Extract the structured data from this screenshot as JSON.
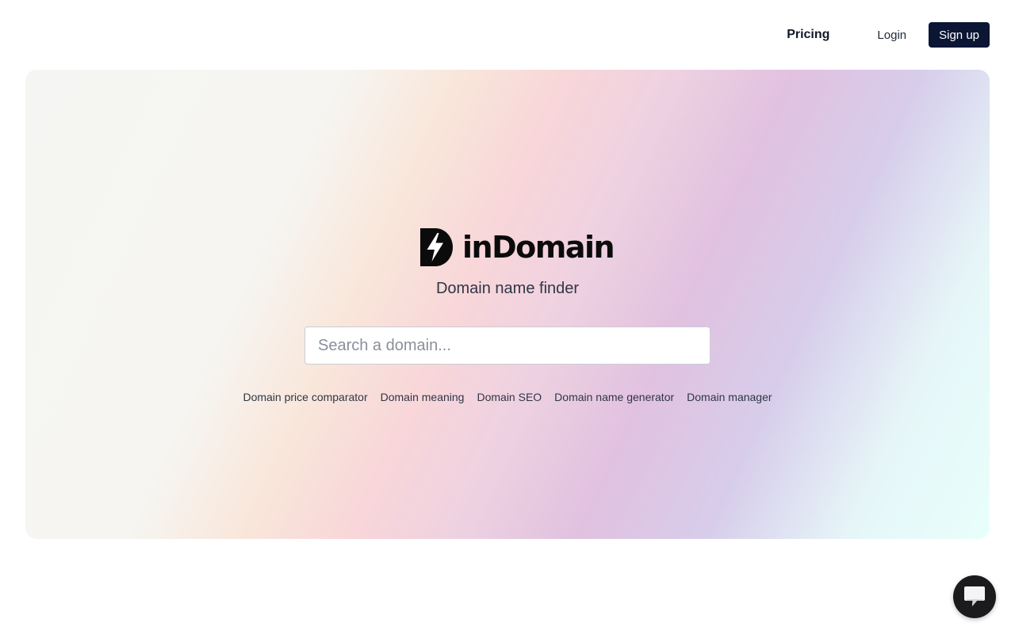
{
  "nav": {
    "pricing": "Pricing",
    "login": "Login",
    "signup": "Sign up"
  },
  "hero": {
    "brand": "inDomain",
    "subtitle": "Domain name finder",
    "search": {
      "placeholder": "Search a domain...",
      "value": ""
    },
    "links": [
      "Domain price comparator",
      "Domain meaning",
      "Domain SEO",
      "Domain name generator",
      "Domain manager"
    ]
  },
  "colors": {
    "signup_bg": "#0b1534",
    "chat_bg": "#1b1b1d",
    "text_primary": "#0f172a",
    "text_secondary": "#2f3646"
  },
  "icons": {
    "logo": "lightning-bolt-icon",
    "chat": "chat-bubble-icon"
  }
}
